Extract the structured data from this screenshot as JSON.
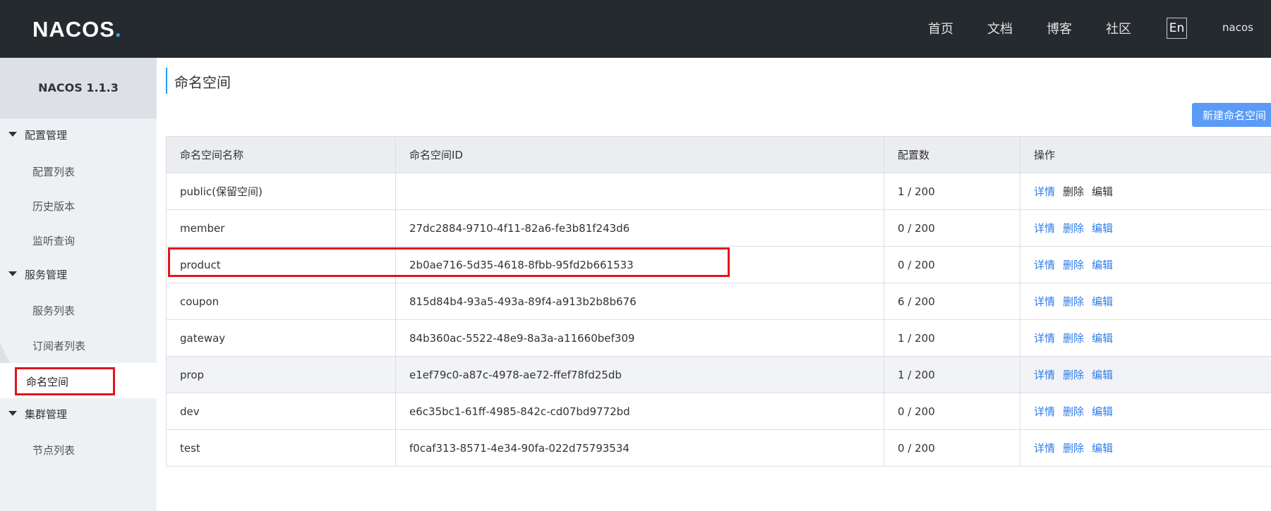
{
  "header": {
    "logo_text": "NACOS",
    "logo_dot": ".",
    "nav": [
      {
        "label": "首页"
      },
      {
        "label": "文档"
      },
      {
        "label": "博客"
      },
      {
        "label": "社区"
      }
    ],
    "lang_label": "En",
    "user": "nacos"
  },
  "sidebar": {
    "version": "NACOS 1.1.3",
    "groups": [
      {
        "label": "配置管理",
        "items": [
          "配置列表",
          "历史版本",
          "监听查询"
        ]
      },
      {
        "label": "服务管理",
        "items": [
          "服务列表",
          "订阅者列表",
          "命名空间"
        ]
      },
      {
        "label": "集群管理",
        "items": [
          "节点列表"
        ]
      }
    ],
    "active_item": "命名空间"
  },
  "main": {
    "title": "命名空间",
    "new_button": "新建命名空间",
    "table": {
      "headers": [
        "命名空间名称",
        "命名空间ID",
        "配置数",
        "操作"
      ],
      "actions": [
        "详情",
        "删除",
        "编辑"
      ],
      "rows": [
        {
          "name": "public(保留空间)",
          "id": "",
          "count": "1 / 200"
        },
        {
          "name": "member",
          "id": "27dc2884-9710-4f11-82a6-fe3b81f243d6",
          "count": "0 / 200"
        },
        {
          "name": "product",
          "id": "2b0ae716-5d35-4618-8fbb-95fd2b661533",
          "count": "0 / 200"
        },
        {
          "name": "coupon",
          "id": "815d84b4-93a5-493a-89f4-a913b2b8b676",
          "count": "6 / 200"
        },
        {
          "name": "gateway",
          "id": "84b360ac-5522-48e9-8a3a-a11660bef309",
          "count": "1 / 200"
        },
        {
          "name": "prop",
          "id": "e1ef79c0-a87c-4978-ae72-ffef78fd25db",
          "count": "1 / 200"
        },
        {
          "name": "dev",
          "id": "e6c35bc1-61ff-4985-842c-cd07bd9772bd",
          "count": "0 / 200"
        },
        {
          "name": "test",
          "id": "f0caf313-8571-4e34-90fa-022d75793534",
          "count": "0 / 200"
        }
      ]
    }
  },
  "colors": {
    "topbar": "#252a2f",
    "accent": "#2d7ce8",
    "button": "#5b9bf7",
    "highlight_box": "#e4141b"
  }
}
